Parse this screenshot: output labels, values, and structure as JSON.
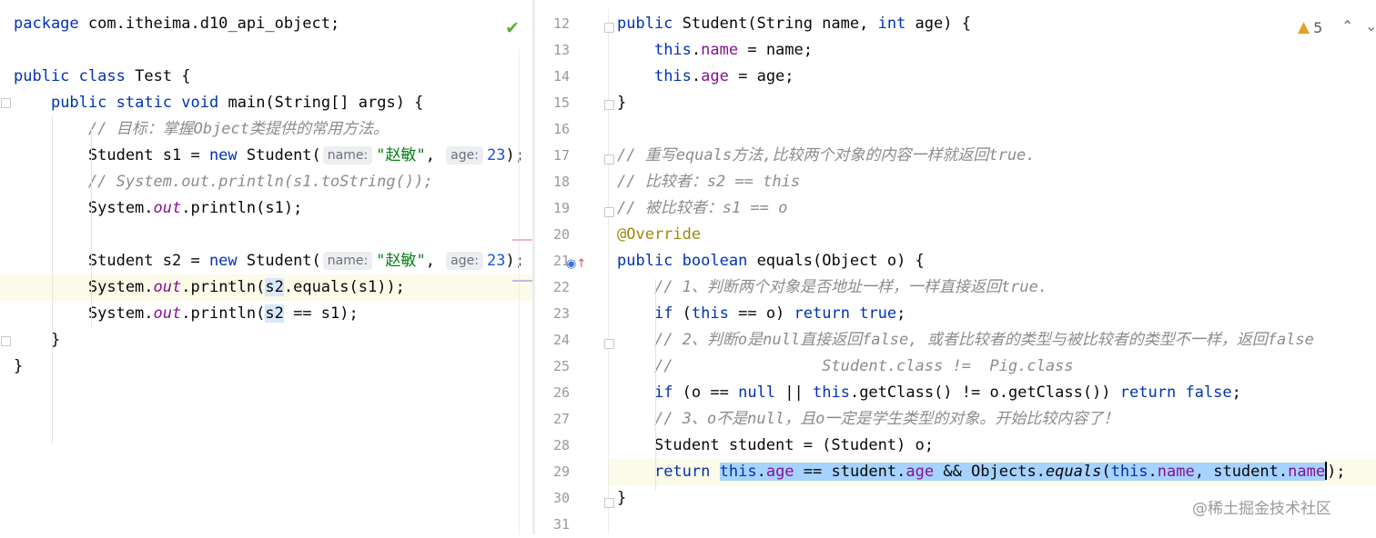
{
  "left_editor": {
    "lines": [
      {
        "parts": [
          {
            "t": "package",
            "c": "kw"
          },
          {
            "t": " com.itheima.d10_api_object;"
          }
        ]
      },
      {
        "parts": []
      },
      {
        "parts": [
          {
            "t": "public",
            "c": "kw"
          },
          {
            "t": " "
          },
          {
            "t": "class",
            "c": "kw"
          },
          {
            "t": " Test {"
          }
        ]
      },
      {
        "parts": [
          {
            "t": "    "
          },
          {
            "t": "public",
            "c": "kw"
          },
          {
            "t": " "
          },
          {
            "t": "static",
            "c": "kw"
          },
          {
            "t": " "
          },
          {
            "t": "void",
            "c": "kw"
          },
          {
            "t": " main(String[] args) {"
          }
        ]
      },
      {
        "parts": [
          {
            "t": "        "
          },
          {
            "t": "// 目标：掌握Object类提供的常用方法。",
            "c": "cm"
          }
        ]
      },
      {
        "parts": [
          {
            "t": "        Student s1 = "
          },
          {
            "t": "new",
            "c": "kw"
          },
          {
            "t": " Student("
          },
          {
            "t": "name:",
            "c": "hint"
          },
          {
            "t": "\"赵敏\"",
            "c": "str"
          },
          {
            "t": ", "
          },
          {
            "t": "age:",
            "c": "hint"
          },
          {
            "t": "23",
            "c": "num"
          },
          {
            "t": ");"
          }
        ]
      },
      {
        "parts": [
          {
            "t": "        "
          },
          {
            "t": "// System.out.println(s1.toString());",
            "c": "cm"
          }
        ]
      },
      {
        "parts": [
          {
            "t": "        System."
          },
          {
            "t": "out",
            "c": "fld it"
          },
          {
            "t": ".println(s1);"
          }
        ]
      },
      {
        "parts": []
      },
      {
        "parts": [
          {
            "t": "        Student s2 = "
          },
          {
            "t": "new",
            "c": "kw"
          },
          {
            "t": " Student("
          },
          {
            "t": "name:",
            "c": "hint"
          },
          {
            "t": "\"赵敏\"",
            "c": "str"
          },
          {
            "t": ", "
          },
          {
            "t": "age:",
            "c": "hint"
          },
          {
            "t": "23",
            "c": "num"
          },
          {
            "t": ");"
          }
        ]
      },
      {
        "parts": [
          {
            "t": "        System."
          },
          {
            "t": "out",
            "c": "fld it"
          },
          {
            "t": ".println("
          },
          {
            "t": "s2",
            "c": "usage"
          },
          {
            "t": ".equals(s1));"
          }
        ],
        "hl": true
      },
      {
        "parts": [
          {
            "t": "        System."
          },
          {
            "t": "out",
            "c": "fld it"
          },
          {
            "t": ".println("
          },
          {
            "t": "s2",
            "c": "usage"
          },
          {
            "t": " == s1);"
          }
        ]
      },
      {
        "parts": [
          {
            "t": "    }"
          }
        ]
      },
      {
        "parts": [
          {
            "t": "}"
          }
        ]
      }
    ]
  },
  "right_editor": {
    "inspections": {
      "warning_count": "5",
      "up": "⌃",
      "down": "⌄"
    },
    "lines": [
      {
        "n": "12",
        "parts": [
          {
            "t": "public",
            "c": "kw"
          },
          {
            "t": " Student(String name, "
          },
          {
            "t": "int",
            "c": "kw"
          },
          {
            "t": " age) {"
          }
        ]
      },
      {
        "n": "13",
        "parts": [
          {
            "t": "    "
          },
          {
            "t": "this",
            "c": "kw"
          },
          {
            "t": "."
          },
          {
            "t": "name",
            "c": "fld"
          },
          {
            "t": " = name;"
          }
        ]
      },
      {
        "n": "14",
        "parts": [
          {
            "t": "    "
          },
          {
            "t": "this",
            "c": "kw"
          },
          {
            "t": "."
          },
          {
            "t": "age",
            "c": "fld"
          },
          {
            "t": " = age;"
          }
        ]
      },
      {
        "n": "15",
        "parts": [
          {
            "t": "}"
          }
        ]
      },
      {
        "n": "16",
        "parts": []
      },
      {
        "n": "17",
        "parts": [
          {
            "t": "// 重写equals方法,比较两个对象的内容一样就返回true.",
            "c": "cm"
          }
        ]
      },
      {
        "n": "18",
        "parts": [
          {
            "t": "// 比较者：s2 == this",
            "c": "cm"
          }
        ]
      },
      {
        "n": "19",
        "parts": [
          {
            "t": "// 被比较者：s1 == o",
            "c": "cm"
          }
        ]
      },
      {
        "n": "20",
        "parts": [
          {
            "t": "@Override",
            "c": "ann"
          }
        ]
      },
      {
        "n": "21",
        "parts": [
          {
            "t": "public",
            "c": "kw"
          },
          {
            "t": " "
          },
          {
            "t": "boolean",
            "c": "kw"
          },
          {
            "t": " equals(Object o) {"
          }
        ]
      },
      {
        "n": "22",
        "parts": [
          {
            "t": "    "
          },
          {
            "t": "// 1、判断两个对象是否地址一样，一样直接返回true.",
            "c": "cm"
          }
        ]
      },
      {
        "n": "23",
        "parts": [
          {
            "t": "    "
          },
          {
            "t": "if",
            "c": "kw"
          },
          {
            "t": " ("
          },
          {
            "t": "this",
            "c": "kw"
          },
          {
            "t": " == o) "
          },
          {
            "t": "return",
            "c": "kw"
          },
          {
            "t": " "
          },
          {
            "t": "true",
            "c": "kw"
          },
          {
            "t": ";"
          }
        ]
      },
      {
        "n": "24",
        "parts": [
          {
            "t": "    "
          },
          {
            "t": "// 2、判断o是null直接返回false, 或者比较者的类型与被比较者的类型不一样，返回false",
            "c": "cm"
          }
        ]
      },
      {
        "n": "25",
        "parts": [
          {
            "t": "    "
          },
          {
            "t": "//                Student.class !=  Pig.class",
            "c": "cm"
          }
        ]
      },
      {
        "n": "26",
        "parts": [
          {
            "t": "    "
          },
          {
            "t": "if",
            "c": "kw"
          },
          {
            "t": " (o == "
          },
          {
            "t": "null",
            "c": "kw"
          },
          {
            "t": " || "
          },
          {
            "t": "this",
            "c": "kw"
          },
          {
            "t": ".getClass() != o.getClass()) "
          },
          {
            "t": "return",
            "c": "kw"
          },
          {
            "t": " "
          },
          {
            "t": "false",
            "c": "kw"
          },
          {
            "t": ";"
          }
        ]
      },
      {
        "n": "27",
        "parts": [
          {
            "t": "    "
          },
          {
            "t": "// 3、o不是null，且o一定是学生类型的对象。开始比较内容了！",
            "c": "cm"
          }
        ]
      },
      {
        "n": "28",
        "parts": [
          {
            "t": "    Student student = (Student) o;"
          }
        ]
      },
      {
        "n": "29",
        "parts": [
          {
            "t": "    "
          },
          {
            "t": "return",
            "c": "kw"
          },
          {
            "t": " "
          },
          {
            "t": "this",
            "c": "kw sel"
          },
          {
            "t": ".",
            "c": "sel"
          },
          {
            "t": "age",
            "c": "fld sel"
          },
          {
            "t": " == student.",
            "c": "sel"
          },
          {
            "t": "age",
            "c": "fld sel"
          },
          {
            "t": " && Objects.",
            "c": "sel"
          },
          {
            "t": "equals",
            "c": "it sel"
          },
          {
            "t": "(",
            "c": "sel"
          },
          {
            "t": "this",
            "c": "kw sel"
          },
          {
            "t": ".",
            "c": "sel"
          },
          {
            "t": "name",
            "c": "fld sel"
          },
          {
            "t": ", student.",
            "c": "sel"
          },
          {
            "t": "name",
            "c": "fld sel"
          },
          {
            "t": "",
            "c": "caret"
          },
          {
            "t": ");"
          }
        ],
        "hl": true
      },
      {
        "n": "30",
        "parts": [
          {
            "t": "}"
          }
        ]
      },
      {
        "n": "31",
        "parts": []
      }
    ]
  },
  "watermark": "@稀土掘金技术社区",
  "colors": {
    "keyword": "#0033b3",
    "field": "#871094",
    "string": "#067d17",
    "comment": "#8c8c8c",
    "number": "#1750eb",
    "annotation": "#9e880d",
    "selection": "#a6d2ff",
    "current_line": "#fcfae8"
  }
}
